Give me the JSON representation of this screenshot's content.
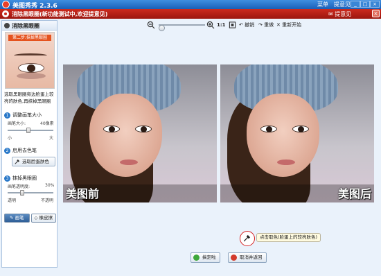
{
  "app": {
    "title": "美图秀秀 2.3.6",
    "menu_left": "菜单",
    "menu_right": "提意见"
  },
  "panel": {
    "title": "消除黑眼圈(新功能测试中,欢迎提意见)",
    "feedback": "提意见"
  },
  "sidebar": {
    "title": "消除黑眼圈",
    "demo_tag": "第二步:抹掉黑眼圈",
    "description": "选取黑眼圈旁边脸蛋上较亮的肤色,再抹掉黑眼圈",
    "step1": {
      "title": "调整画笔大小",
      "size_label": "画笔大小:",
      "size_value": "40像素",
      "min": "小",
      "max": "大",
      "level": 0.45
    },
    "step2": {
      "title": "启用去色笔",
      "pick_button": "选取脸蛋肤色"
    },
    "step3": {
      "title": "抹掉黑眼圈",
      "opacity_label": "画笔透明度:",
      "opacity_value": "30%",
      "min": "透明",
      "max": "不透明",
      "level": 0.3
    },
    "modes": {
      "brush": "画笔",
      "eraser": "橡皮擦"
    }
  },
  "toolbar": {
    "ratio": "1:1",
    "undo": "撤销",
    "redo": "重做",
    "reset": "重新开始",
    "zoom_level": 0.0
  },
  "photos": {
    "before": "美图前",
    "after": "美图后"
  },
  "tooltip": "点击取色(脸蛋上的较亮肤色)",
  "actions": {
    "ok": "搞定啦",
    "cancel": "取消并返回"
  },
  "icons": [
    "zoom-out-icon",
    "zoom-in-icon",
    "fit-icon",
    "undo-icon",
    "redo-icon",
    "reset-icon",
    "eyedropper-icon",
    "check-icon",
    "cancel-icon"
  ]
}
